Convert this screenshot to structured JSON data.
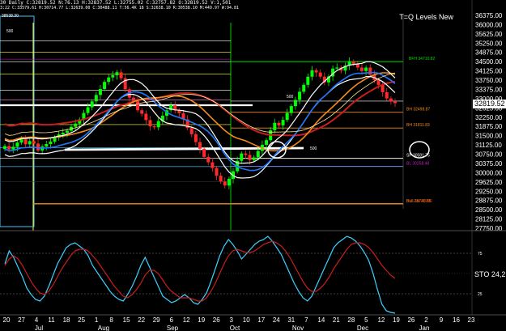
{
  "header": {
    "line1": "30 Daily C:32819.52 N:76.13 H:32837.52 L:32755.02 C:32757.82 O:32819.52 V:1,501",
    "line2": "3:22 C:33579.61 H:30714.77 L:32639.00 C:30488.11 T:56.4K 18 S:32638.10 R:30538.10 M:449.97 W:94.81",
    "topleft_value": "38538.30"
  },
  "title": "T=Q Levels New",
  "last_price": "32819.52",
  "indicator_label": "STO 24,2",
  "colors": {
    "background": "#000000",
    "up_candle": "#00ff00",
    "down_candle": "#ff2a2a",
    "ma_red": "#c81e1e",
    "ma_orange": "#f08c1e",
    "ma_white": "#ffffff",
    "ma_blue": "#1e78ff",
    "sto_k": "#3cd2ff",
    "sto_d": "#c81e1e"
  },
  "chart_data": [
    {
      "type": "candlestick",
      "title": "",
      "ylim": [
        27750,
        36375
      ],
      "y_ticks": [
        "36375.00",
        "36000.00",
        "35625.00",
        "35250.00",
        "34875.00",
        "34500.00",
        "34125.00",
        "33750.00",
        "33375.00",
        "33000.00",
        "32625.00",
        "32250.00",
        "31875.00",
        "31500.00",
        "31125.00",
        "30750.00",
        "30375.00",
        "30000.00",
        "29625.00",
        "29250.00",
        "28875.00",
        "28500.00",
        "28125.00",
        "27750.00"
      ],
      "x_day_labels": [
        "20",
        "27",
        "4",
        "11",
        "18",
        "25",
        "1",
        "8",
        "15",
        "22",
        "29",
        "6",
        "12",
        "19",
        "26",
        "3",
        "10",
        "17",
        "24",
        "31",
        "7",
        "14",
        "21",
        "28",
        "5",
        "12",
        "19",
        "26",
        "2",
        "9",
        "16",
        "23"
      ],
      "x_month_labels": [
        "Jul",
        "Aug",
        "Sep",
        "Oct",
        "Nov",
        "Dec",
        "Jan"
      ],
      "close": [
        31080,
        30940,
        31050,
        31220,
        31350,
        31150,
        31280,
        31180,
        30900,
        31060,
        31160,
        31260,
        31420,
        31550,
        31620,
        31700,
        31860,
        31990,
        32160,
        32420,
        32650,
        32890,
        33150,
        33390,
        33680,
        33860,
        33950,
        34070,
        33830,
        33380,
        33040,
        32900,
        32530,
        32390,
        32130,
        31880,
        31840,
        32090,
        32310,
        32530,
        32730,
        32520,
        32410,
        32160,
        31810,
        31560,
        31240,
        30970,
        30640,
        30420,
        30190,
        29880,
        29640,
        29480,
        29750,
        30060,
        30480,
        30780,
        30720,
        30510,
        30620,
        30880,
        31130,
        31320,
        31720,
        32020,
        31920,
        32140,
        32420,
        32700,
        32950,
        33280,
        33560,
        33890,
        34150,
        34060,
        33890,
        33660,
        33900,
        34220,
        34260,
        34140,
        34340,
        34500,
        34410,
        34260,
        34120,
        34260,
        33970,
        33760,
        33560,
        33260,
        33010,
        32880,
        32820
      ],
      "levels": [
        {
          "label": "BFH 34710.82",
          "value": 34500,
          "color": "#00dc00"
        },
        {
          "label": "BH 32498.87",
          "value": 32450,
          "color": "#f08c1e"
        },
        {
          "label": "BH 31811.83",
          "value": 31811,
          "color": "#f08c1e"
        },
        {
          "label": "SP 30581.75",
          "value": 30581,
          "color": "#ffffff"
        },
        {
          "label": "BL 30258.48",
          "value": 30258,
          "color": "#c81ec8"
        },
        {
          "label": "BL Low 28740",
          "value": 28740,
          "color": "#c81e1e"
        },
        {
          "label": "Bull 28740.85",
          "value": 28740,
          "color": "#f08c1e"
        }
      ],
      "annotations": [
        "500",
        "500",
        "500"
      ]
    },
    {
      "type": "line",
      "title": "",
      "indicator": "STO 24,2",
      "series": [
        {
          "name": "",
          "values": [
            62,
            78,
            70,
            58,
            46,
            32,
            24,
            18,
            16,
            22,
            34,
            48,
            62,
            72,
            82,
            86,
            88,
            84,
            80,
            72,
            60,
            52,
            44,
            36,
            28,
            22,
            18,
            16,
            24,
            34,
            46,
            60,
            70,
            58,
            46,
            34,
            22,
            18,
            14,
            16,
            20,
            24,
            20,
            14,
            12,
            18,
            26,
            40,
            56,
            72,
            84,
            92,
            86,
            78,
            68,
            74,
            80,
            86,
            90,
            92,
            96,
            90,
            82,
            74,
            62,
            50,
            38,
            28,
            20,
            16,
            22,
            34,
            46,
            58,
            70,
            82,
            88,
            92,
            96,
            94,
            90,
            84,
            76,
            66,
            50,
            30,
            12,
            4,
            2,
            1
          ]
        },
        {
          "name": "",
          "values": [
            60,
            68,
            72,
            68,
            60,
            50,
            40,
            32,
            26,
            24,
            28,
            36,
            46,
            56,
            64,
            72,
            78,
            80,
            80,
            78,
            72,
            66,
            58,
            50,
            42,
            34,
            28,
            22,
            20,
            24,
            30,
            38,
            48,
            54,
            54,
            50,
            42,
            34,
            28,
            24,
            20,
            20,
            20,
            18,
            16,
            16,
            20,
            28,
            38,
            50,
            62,
            72,
            78,
            80,
            78,
            76,
            76,
            78,
            82,
            86,
            88,
            90,
            88,
            84,
            78,
            70,
            60,
            50,
            40,
            32,
            28,
            28,
            32,
            38,
            46,
            56,
            64,
            72,
            80,
            86,
            88,
            88,
            86,
            82,
            76,
            68,
            60,
            54,
            48,
            44
          ]
        }
      ],
      "ylim": [
        0,
        100
      ],
      "levels": [
        25,
        75
      ]
    }
  ]
}
